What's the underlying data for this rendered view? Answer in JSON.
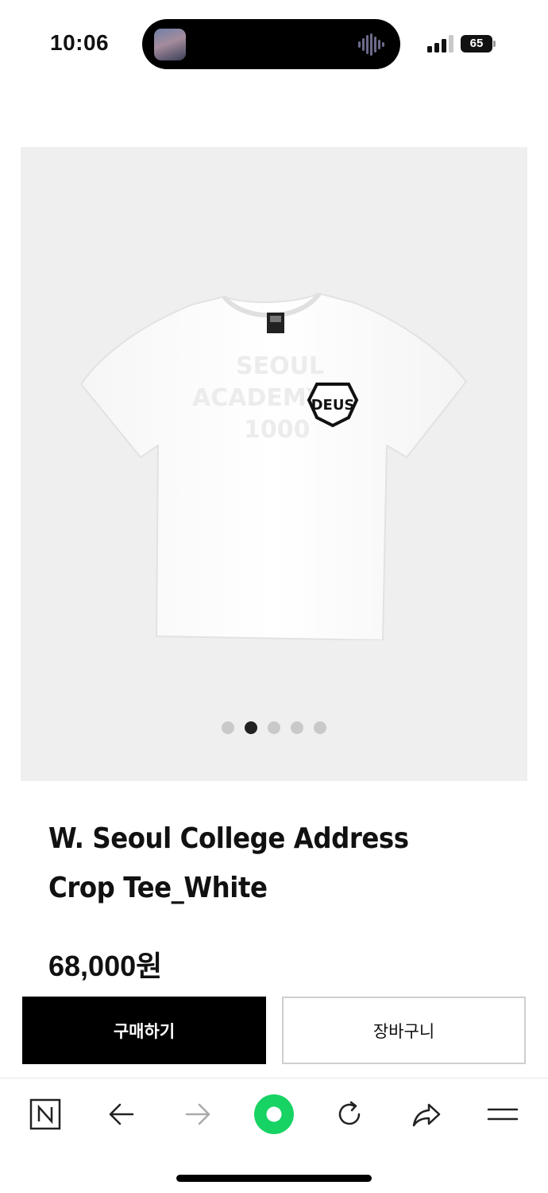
{
  "status_bar": {
    "time": "10:06",
    "battery": "65"
  },
  "gallery": {
    "image_count": 5,
    "active_index": 1,
    "logo_text": "DEUS"
  },
  "product": {
    "title": "W. Seoul College Address Crop Tee_White",
    "price": "68,000원"
  },
  "actions": {
    "buy_label": "구매하기",
    "cart_label": "장바구니"
  },
  "browser_toolbar": {
    "items": [
      "naver-logo-icon",
      "back-arrow-icon",
      "forward-arrow-icon",
      "green-dot-icon",
      "refresh-icon",
      "share-icon",
      "menu-icon"
    ]
  },
  "colors": {
    "brand_green": "#17d364",
    "buy_button": "#000000",
    "gallery_bg": "#efefef"
  }
}
